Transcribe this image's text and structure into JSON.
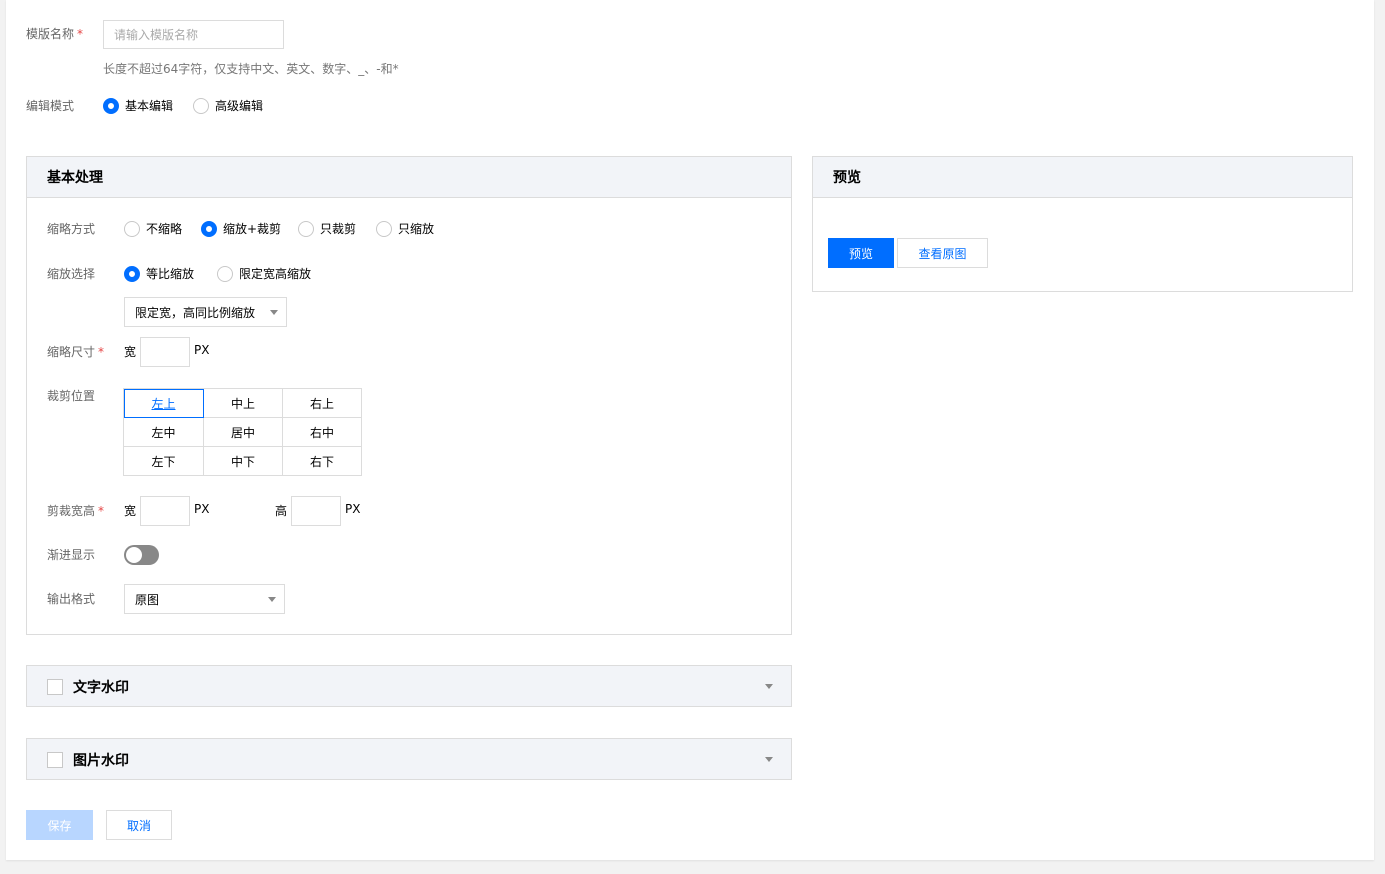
{
  "form": {
    "template_name": {
      "label": "模版名称",
      "required_mark": "*",
      "placeholder": "请输入模版名称",
      "value": "",
      "help": "长度不超过64字符，仅支持中文、英文、数字、_、-和*"
    },
    "edit_mode": {
      "label": "编辑模式",
      "options": [
        "基本编辑",
        "高级编辑"
      ],
      "selected": "基本编辑"
    }
  },
  "basic_panel": {
    "title": "基本处理",
    "thumbnail_mode": {
      "label": "缩略方式",
      "options": [
        "不缩略",
        "缩放+裁剪",
        "只裁剪",
        "只缩放"
      ],
      "selected": "缩放+裁剪"
    },
    "scale_choice": {
      "label": "缩放选择",
      "options": [
        "等比缩放",
        "限定宽高缩放"
      ],
      "selected": "等比缩放",
      "dropdown_value": "限定宽，高同比例缩放"
    },
    "thumbnail_size": {
      "label": "缩略尺寸",
      "required_mark": "*",
      "width_label": "宽",
      "unit": "PX",
      "width_value": ""
    },
    "crop_position": {
      "label": "裁剪位置",
      "cells": [
        "左上",
        "中上",
        "右上",
        "左中",
        "居中",
        "右中",
        "左下",
        "中下",
        "右下"
      ],
      "selected": "左上"
    },
    "crop_size": {
      "label": "剪裁宽高",
      "required_mark": "*",
      "width_label": "宽",
      "height_label": "高",
      "unit": "PX",
      "width_value": "",
      "height_value": ""
    },
    "progressive": {
      "label": "渐进显示",
      "enabled": false
    },
    "output_format": {
      "label": "输出格式",
      "value": "原图"
    }
  },
  "text_watermark": {
    "title": "文字水印",
    "checked": false
  },
  "image_watermark": {
    "title": "图片水印",
    "checked": false
  },
  "preview_panel": {
    "title": "预览",
    "preview_button": "预览",
    "view_original_button": "查看原图"
  },
  "actions": {
    "save": "保存",
    "cancel": "取消"
  },
  "colors": {
    "primary": "#006eff",
    "panel_header": "#f2f4f8",
    "border": "#dcdcdc",
    "required": "#e54545",
    "save_disabled": "#b8d6ff"
  }
}
